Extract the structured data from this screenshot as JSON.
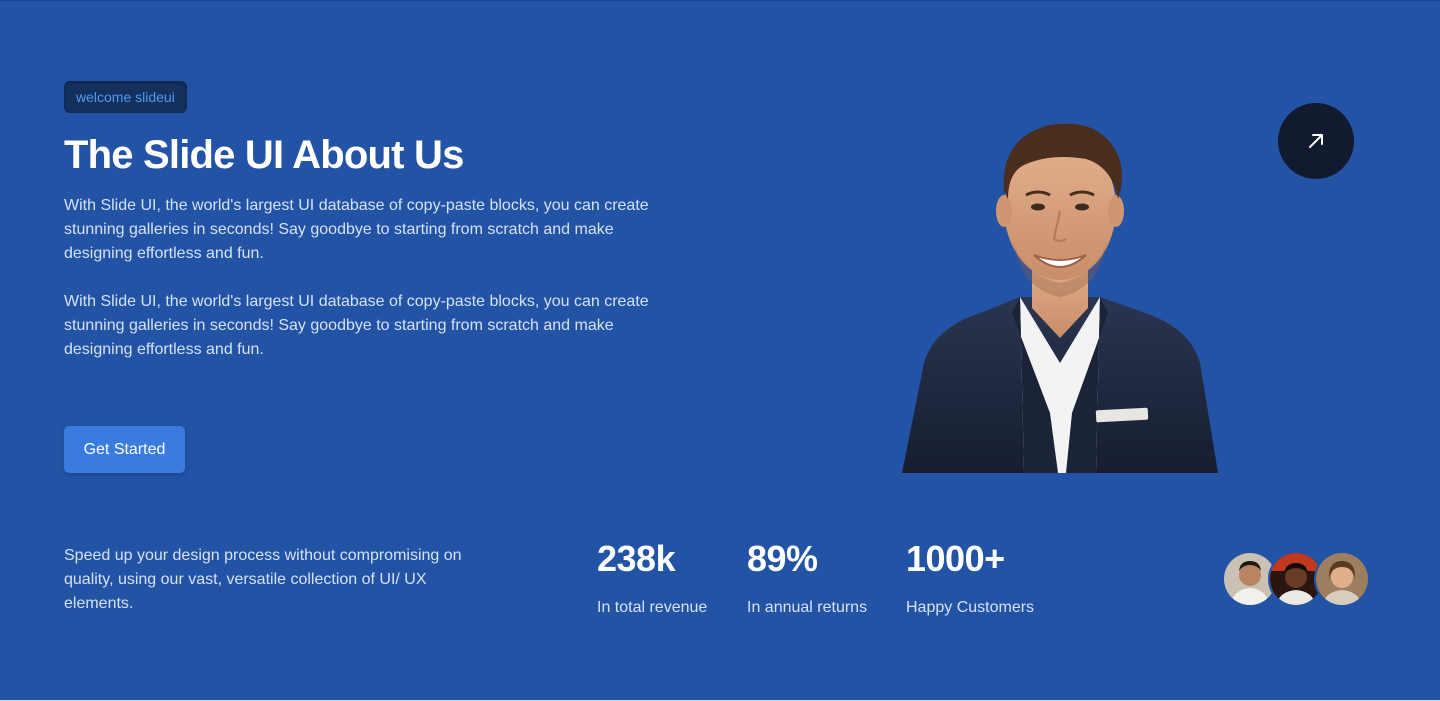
{
  "badge": {
    "label": "welcome slideui"
  },
  "hero": {
    "title": "The Slide UI About Us",
    "paragraph_1": "With Slide UI, the world's largest UI database of copy-paste blocks, you can create stunning galleries in seconds! Say goodbye to starting from scratch and make designing effortless and fun.",
    "paragraph_2": "With Slide UI, the world's largest UI database of copy-paste blocks, you can create stunning galleries in seconds! Say goodbye to starting from scratch and make designing effortless and fun.",
    "cta_label": "Get Started"
  },
  "arrow_button": {
    "icon": "arrow-up-right-icon"
  },
  "stats_section": {
    "description": "Speed up your design process without compromising on quality, using our vast, versatile collection of UI/ UX elements.",
    "stats": [
      {
        "value": "238k",
        "label": "In total revenue"
      },
      {
        "value": "89%",
        "label": "In annual returns"
      },
      {
        "value": "1000+",
        "label": "Happy Customers"
      }
    ]
  },
  "colors": {
    "background": "#2253a5",
    "badge_bg": "#14305e",
    "badge_text": "#4c9bf0",
    "cta_bg": "#3a7be0",
    "arrow_button_bg": "#121a30",
    "body_text": "#d6e2f5"
  }
}
